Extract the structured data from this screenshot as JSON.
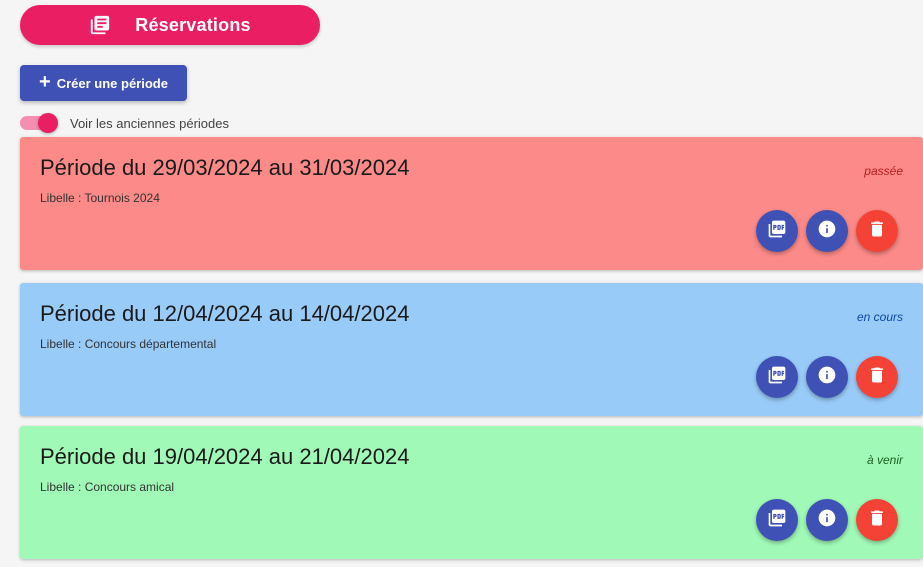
{
  "header": {
    "title": "Réservations",
    "icon": "library-books-icon",
    "color": "#e91e63"
  },
  "toolbar": {
    "create_label": "Créer une période",
    "create_icon": "plus-icon",
    "create_color": "#3f51b5"
  },
  "toggle": {
    "label": "Voir les anciennes périodes",
    "checked": true
  },
  "periods": [
    {
      "title": "Période du 29/03/2024 au 31/03/2024",
      "libelle": "Libelle : Tournois 2024",
      "status": "passée",
      "status_color": "#b71c1c",
      "bg_color": "#fc8a88"
    },
    {
      "title": "Période du 12/04/2024 au 14/04/2024",
      "libelle": "Libelle : Concours départemental",
      "status": "en cours",
      "status_color": "#0d47a1",
      "bg_color": "#99cbf9"
    },
    {
      "title": "Période du 19/04/2024 au 21/04/2024",
      "libelle": "Libelle : Concours amical",
      "status": "à venir",
      "status_color": "#1b5e20",
      "bg_color": "#a0f9b7"
    }
  ],
  "actions": [
    {
      "icon": "pdf-icon",
      "color": "#3f51b5"
    },
    {
      "icon": "info-icon",
      "color": "#3f51b5"
    },
    {
      "icon": "trash-icon",
      "color": "#f44336"
    }
  ]
}
